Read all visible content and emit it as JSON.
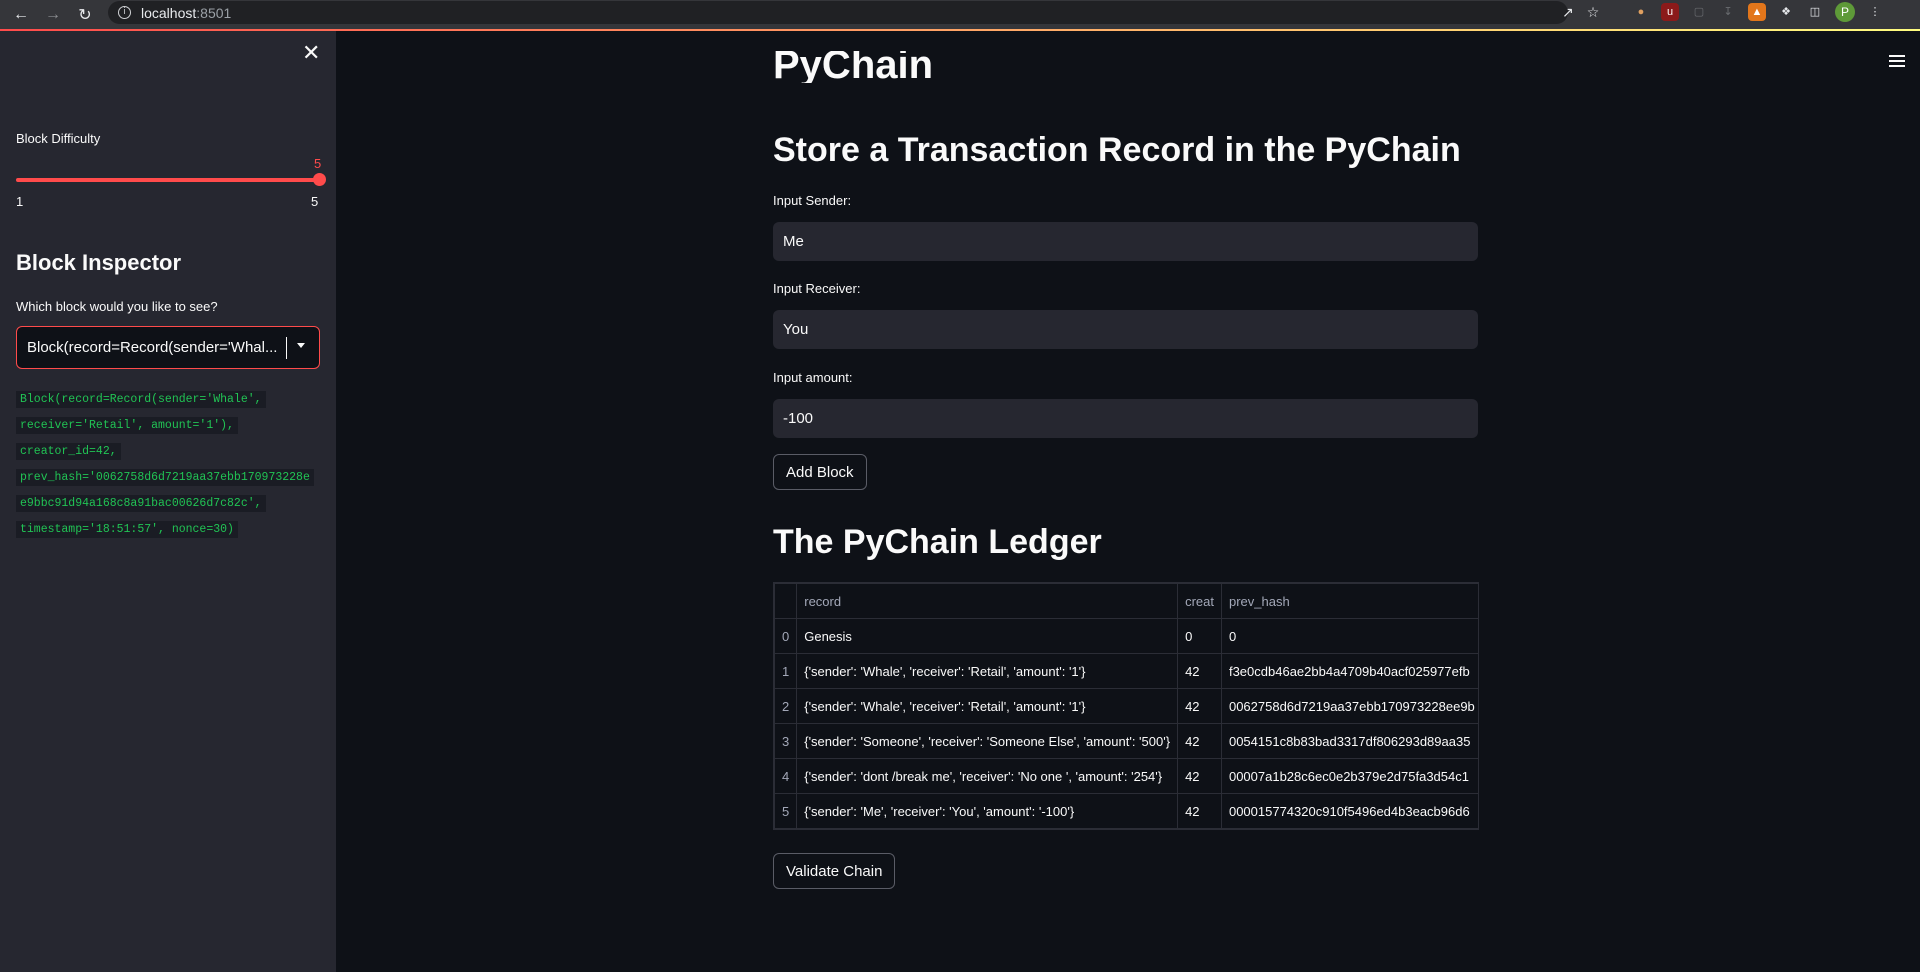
{
  "browser": {
    "url_host": "localhost",
    "url_port": ":8501",
    "avatar_letter": "P"
  },
  "sidebar": {
    "difficulty_label": "Block Difficulty",
    "difficulty_value": "5",
    "difficulty_min": "1",
    "difficulty_max": "5",
    "difficulty_level": 1.0,
    "inspector_heading": "Block Inspector",
    "select_label": "Which block would you like to see?",
    "select_value": "Block(record=Record(sender='Whal...",
    "block_code": [
      "Block(record=Record(sender='Whale',",
      "receiver='Retail', amount='1'),",
      "creator_id=42,",
      "prev_hash='0062758d6d7219aa37ebb170973228e",
      "e9bbc91d94a168c8a91bac00626d7c82c',",
      "timestamp='18:51:57', nonce=30)"
    ]
  },
  "main": {
    "title": "PyChain",
    "store_heading": "Store a Transaction Record in the PyChain",
    "sender_label": "Input Sender:",
    "sender_value": "Me",
    "receiver_label": "Input Receiver:",
    "receiver_value": "You",
    "amount_label": "Input amount:",
    "amount_value": "-100",
    "add_block_label": "Add Block",
    "ledger_heading": "The PyChain Ledger",
    "validate_label": "Validate Chain"
  },
  "ledger": {
    "columns": [
      "",
      "record",
      "creat",
      "prev_hash"
    ],
    "rows": [
      {
        "idx": "0",
        "record": "Genesis",
        "creator": "0",
        "prev_hash": "0"
      },
      {
        "idx": "1",
        "record": "{'sender': 'Whale', 'receiver': 'Retail', 'amount': '1'}",
        "creator": "42",
        "prev_hash": "f3e0cdb46ae2bb4a4709b40acf025977efb"
      },
      {
        "idx": "2",
        "record": "{'sender': 'Whale', 'receiver': 'Retail', 'amount': '1'}",
        "creator": "42",
        "prev_hash": "0062758d6d7219aa37ebb170973228ee9b"
      },
      {
        "idx": "3",
        "record": "{'sender': 'Someone', 'receiver': 'Someone Else', 'amount': '500'}",
        "creator": "42",
        "prev_hash": "0054151c8b83bad3317df806293d89aa35"
      },
      {
        "idx": "4",
        "record": "{'sender': 'dont /break me', 'receiver': 'No one ', 'amount': '254'}",
        "creator": "42",
        "prev_hash": "00007a1b28c6ec0e2b379e2d75fa3d54c1"
      },
      {
        "idx": "5",
        "record": "{'sender': 'Me', 'receiver': 'You', 'amount': '-100'}",
        "creator": "42",
        "prev_hash": "000015774320c910f5496ed4b3eacb96d6"
      }
    ]
  }
}
